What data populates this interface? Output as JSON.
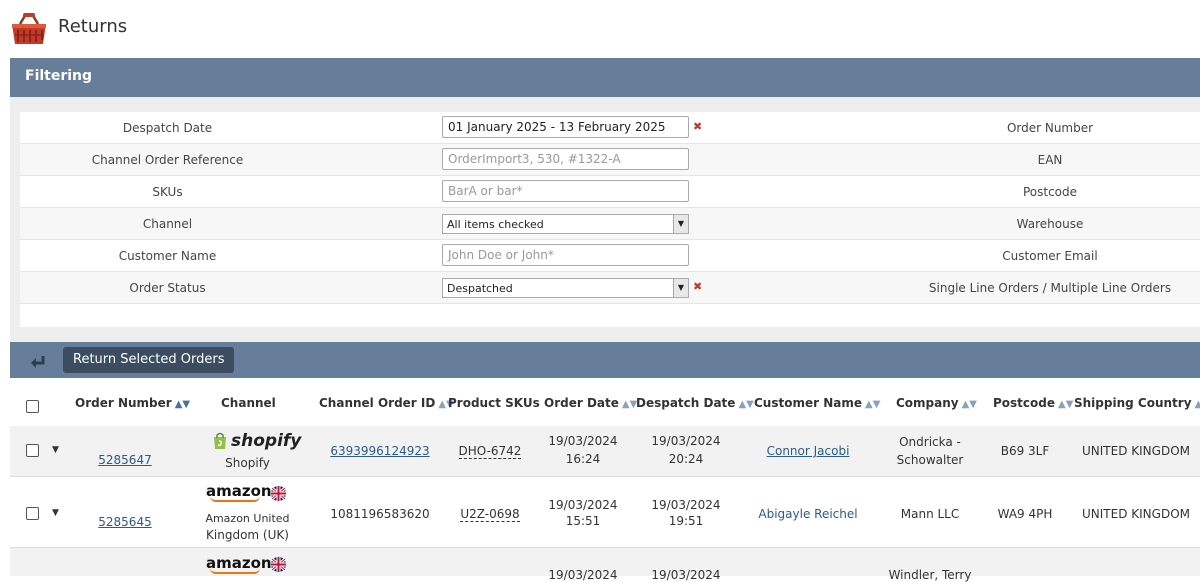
{
  "page": {
    "title": "Returns"
  },
  "filtering": {
    "title": "Filtering",
    "rows": [
      {
        "left_label": "Despatch Date",
        "value": "01 January 2025  -  13 February 2025",
        "right_label": "Order Number"
      },
      {
        "left_label": "Channel Order Reference",
        "placeholder": "OrderImport3, 530, #1322-A",
        "right_label": "EAN"
      },
      {
        "left_label": "SKUs",
        "placeholder": "BarA or bar*",
        "right_label": "Postcode"
      },
      {
        "left_label": "Channel",
        "value": "All items checked",
        "right_label": "Warehouse"
      },
      {
        "left_label": "Customer Name",
        "placeholder": "John Doe or John*",
        "right_label": "Customer Email"
      },
      {
        "left_label": "Order Status",
        "value": "Despatched",
        "right_label": "Single Line Orders / Multiple Line Orders"
      }
    ]
  },
  "orders": {
    "return_button": "Return Selected Orders",
    "columns": [
      "Order Number",
      "Channel",
      "Channel Order ID",
      "Product SKUs",
      "Order Date",
      "Despatch Date",
      "Customer Name",
      "Company",
      "Postcode",
      "Shipping Country"
    ],
    "rows": [
      {
        "order_number": "5285647",
        "channel_logo": "shopify",
        "channel_name": "Shopify",
        "channel_order_id": "6393996124923",
        "sku": "DHO-6742",
        "order_date": "19/03/2024",
        "order_time": "16:24",
        "despatch_date": "19/03/2024",
        "despatch_time": "20:24",
        "customer_name": "Connor Jacobi",
        "company_line1": "Ondricka -",
        "company_line2": "Schowalter",
        "postcode": "B69 3LF",
        "country": "UNITED KINGDOM"
      },
      {
        "order_number": "5285645",
        "channel_logo": "amazon",
        "channel_name_line1": "Amazon United",
        "channel_name_line2": "Kingdom (UK)",
        "channel_order_id": "1081196583620",
        "sku": "U2Z-0698",
        "order_date": "19/03/2024",
        "order_time": "15:51",
        "despatch_date": "19/03/2024",
        "despatch_time": "19:51",
        "customer_name": "Abigayle Reichel",
        "company": "Mann LLC",
        "postcode": "WA9 4PH",
        "country": "UNITED KINGDOM"
      },
      {
        "channel_logo": "amazon",
        "order_date": "19/03/2024",
        "despatch_date": "19/03/2024",
        "company_line1": "Windler, Terry"
      }
    ]
  },
  "logos": {
    "shopify": "shopify",
    "amazon": "amazon"
  },
  "icons": [
    "basket-icon",
    "return-arrow-icon",
    "sort-icon",
    "chevron-down-icon",
    "clear-icon",
    "uk-flag-icon",
    "shopify-bag-icon"
  ],
  "colors": {
    "bar": "#667e9a",
    "button": "#3c4d61",
    "link": "#2a5b8a",
    "amazon_orange": "#e47911",
    "shopify_green": "#95bf47"
  }
}
